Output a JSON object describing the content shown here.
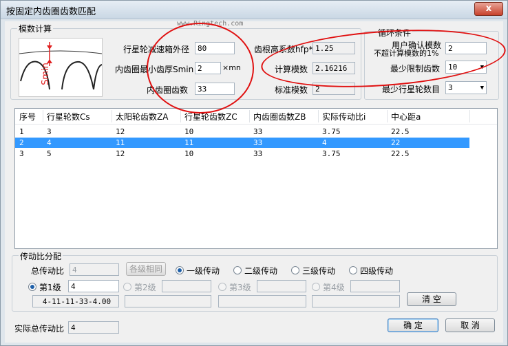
{
  "window": {
    "title": "按固定内齿圈齿数匹配",
    "close": "x"
  },
  "watermark": "www.Ringtech.com",
  "modulus": {
    "group_label": "模数计算",
    "planet_outer_label": "行星轮减速箱外径",
    "planet_outer_value": "80",
    "min_thickness_label": "内齿圈最小齿厚Smin",
    "min_thickness_value": "2",
    "min_thickness_unit": "×mn",
    "ring_teeth_label": "内齿圈齿数",
    "ring_teeth_value": "33",
    "root_coef_label": "齿根高系数hfp*",
    "root_coef_value": "1.25",
    "calc_mod_label": "计算模数",
    "calc_mod_value": "2.16216",
    "std_mod_label": "标准模数",
    "std_mod_value": "2",
    "diagram_label": "Smin"
  },
  "loop": {
    "group_label": "循环条件",
    "user_mod_label1": "用户确认模数",
    "user_mod_label2": "不超计算模数的1%",
    "user_mod_value": "2",
    "min_teeth_label": "最少限制齿数",
    "min_teeth_value": "10",
    "min_planets_label": "最少行星轮数目",
    "min_planets_value": "3"
  },
  "table": {
    "headers": [
      "序号",
      "行星轮数Cs",
      "太阳轮齿数ZA",
      "行星轮齿数ZC",
      "内齿圈齿数ZB",
      "实际传动比i",
      "中心距a"
    ],
    "rows": [
      [
        "1",
        "3",
        "12",
        "10",
        "33",
        "3.75",
        "22.5"
      ],
      [
        "2",
        "4",
        "11",
        "11",
        "33",
        "4",
        "22"
      ],
      [
        "3",
        "5",
        "12",
        "10",
        "33",
        "3.75",
        "22.5"
      ]
    ]
  },
  "ratio": {
    "group_label": "传动比分配",
    "total_label": "总传动比",
    "total_value": "4",
    "same_button": "各级相同",
    "opt1": "一级传动",
    "opt2": "二级传动",
    "opt3": "三级传动",
    "opt4": "四级传动",
    "stage1_label": "第1级",
    "stage1_value": "4",
    "stage2_label": "第2级",
    "stage3_label": "第3级",
    "stage4_label": "第4级",
    "stage1_summary": "4-11-11-33-4.00",
    "clear_button": "清 空"
  },
  "footer": {
    "actual_label": "实际总传动比",
    "actual_value": "4",
    "ok_button": "确 定",
    "cancel_button": "取 消"
  },
  "colors": {
    "accent": "#3399ff",
    "annotation": "#e01010"
  }
}
